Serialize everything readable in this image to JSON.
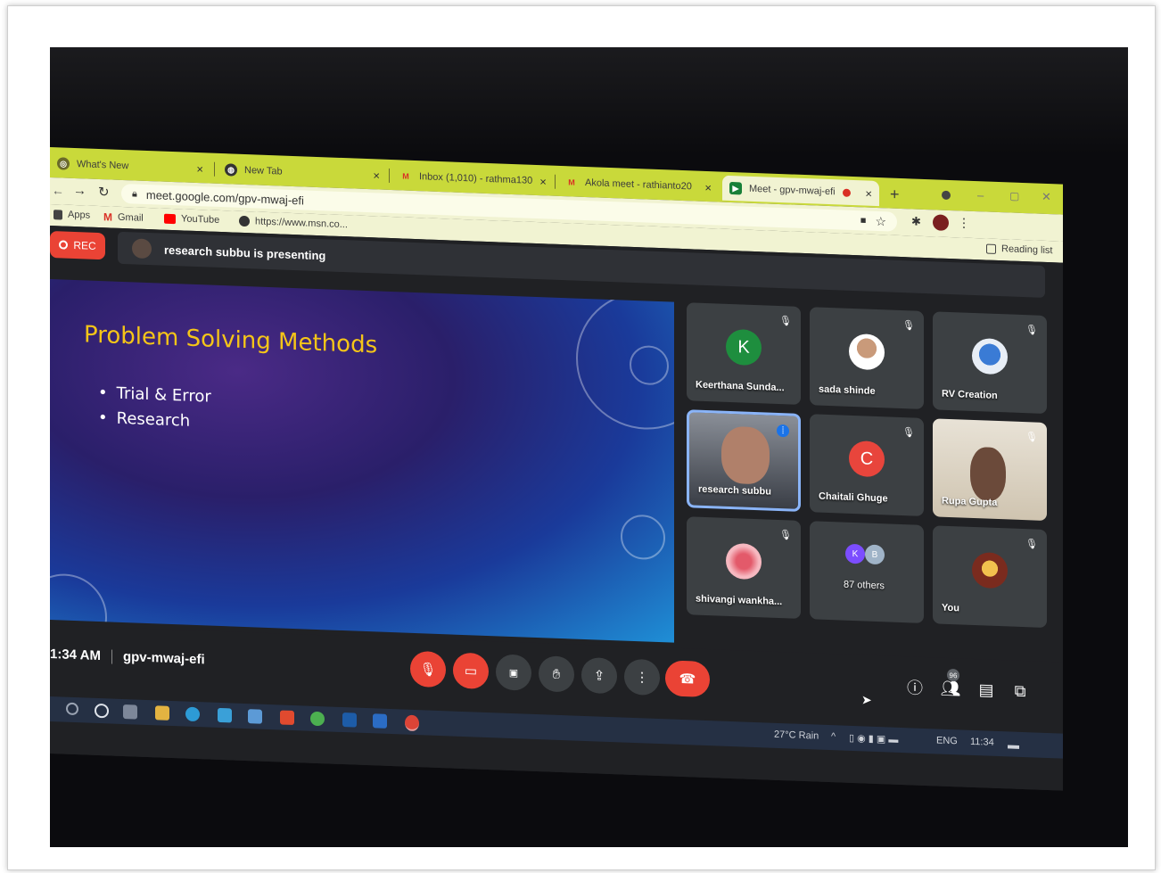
{
  "browser": {
    "tabs": [
      {
        "label": "What's New"
      },
      {
        "label": "New Tab"
      },
      {
        "label": "Inbox (1,010) - rathma130"
      },
      {
        "label": "Akola meet - rathianto20"
      },
      {
        "label": "Meet - gpv-mwaj-efi"
      }
    ],
    "tab_close": "×",
    "new_tab": "+",
    "url": "meet.google.com/gpv-mwaj-efi",
    "bookmarks": [
      {
        "label": "Apps"
      },
      {
        "label": "Gmail"
      },
      {
        "label": "YouTube"
      },
      {
        "label": "https://www.msn.co..."
      }
    ],
    "reading_list": "Reading list"
  },
  "meet": {
    "rec_label": "REC",
    "presenting_text": "research subbu is presenting",
    "slide": {
      "title": "Problem Solving Methods",
      "bullets": [
        "Trial & Error",
        "Research"
      ]
    },
    "participants": [
      {
        "name": "Keerthana Sunda...",
        "initial": "K",
        "color": "#1e8e3e"
      },
      {
        "name": "sada shinde"
      },
      {
        "name": "RV Creation"
      },
      {
        "name": "research subbu"
      },
      {
        "name": "Chaitali Ghuge",
        "initial": "C",
        "color": "#e8453c"
      },
      {
        "name": "Rupa Gupta"
      },
      {
        "name": "shivangi wankha..."
      },
      {
        "name": "87 others",
        "initials": [
          "K",
          "B"
        ]
      },
      {
        "name": "You"
      }
    ],
    "time": "1:34 AM",
    "meeting_code": "gpv-mwaj-efi",
    "people_count": "96"
  },
  "taskbar": {
    "weather": "27°C Rain",
    "language": "ENG",
    "clock": "11:34"
  }
}
